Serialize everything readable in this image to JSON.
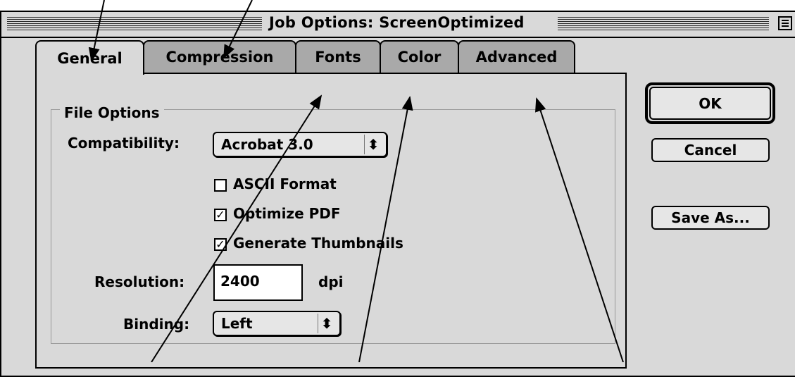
{
  "window": {
    "title": "Job Options: ScreenOptimized"
  },
  "tabs": [
    {
      "label": "General",
      "active": true
    },
    {
      "label": "Compression",
      "active": false
    },
    {
      "label": "Fonts",
      "active": false
    },
    {
      "label": "Color",
      "active": false
    },
    {
      "label": "Advanced",
      "active": false
    }
  ],
  "file_options": {
    "group_label": "File Options",
    "compatibility_label": "Compatibility:",
    "compatibility_value": "Acrobat 3.0",
    "ascii_format_label": "ASCII Format",
    "ascii_format_checked": false,
    "optimize_pdf_label": "Optimize PDF",
    "optimize_pdf_checked": true,
    "thumbnails_label": "Generate Thumbnails",
    "thumbnails_checked": true,
    "resolution_label": "Resolution:",
    "resolution_value": "2400",
    "resolution_unit": "dpi",
    "binding_label": "Binding:",
    "binding_value": "Left"
  },
  "buttons": {
    "ok": "OK",
    "cancel": "Cancel",
    "save_as": "Save As..."
  },
  "glyphs": {
    "check": "✓",
    "updown": "⬍"
  },
  "colors": {
    "dialog_bg": "#d9d9d9",
    "inactive_tab": "#a9a9a9"
  }
}
